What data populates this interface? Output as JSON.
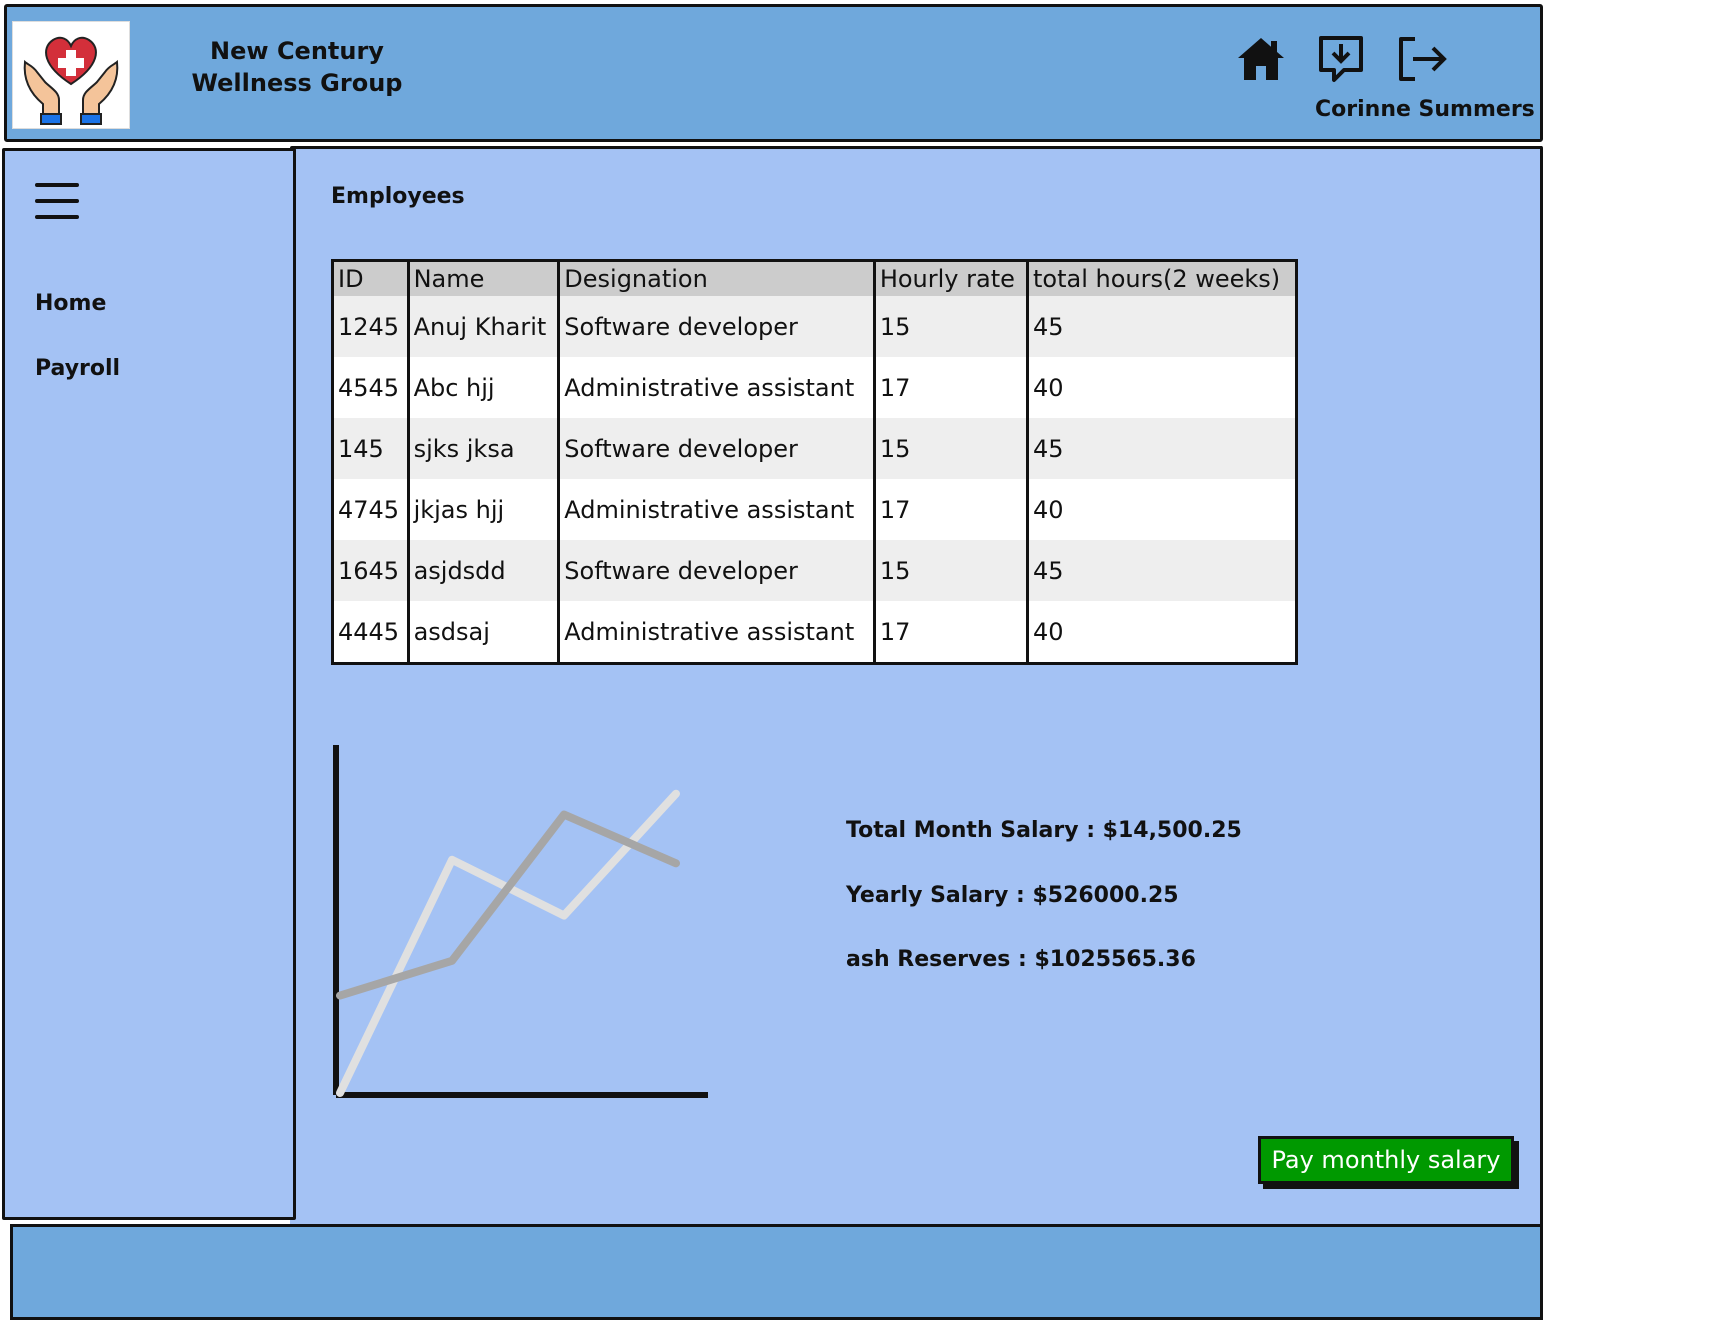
{
  "header": {
    "brand": "New Century Wellness Group",
    "user_name": "Corinne Summers",
    "icons": [
      "home-icon",
      "download-message-icon",
      "logout-icon"
    ]
  },
  "sidebar": {
    "menu_icon": "hamburger-icon",
    "items": [
      {
        "label": "Home"
      },
      {
        "label": "Payroll"
      }
    ]
  },
  "main": {
    "title": "Employees",
    "table": {
      "columns": [
        "ID",
        "Name",
        "Designation",
        "Hourly rate",
        "total hours(2 weeks)"
      ],
      "rows": [
        [
          "1245",
          "Anuj Kharit",
          "Software developer",
          "15",
          "45"
        ],
        [
          "4545",
          "Abc hjj",
          "Administrative assistant",
          "17",
          "40"
        ],
        [
          "145",
          "sjks jksa",
          "Software developer",
          "15",
          "45"
        ],
        [
          "4745",
          "jkjas hjj",
          "Administrative assistant",
          "17",
          "40"
        ],
        [
          "1645",
          "asjdsdd",
          "Software developer",
          "15",
          "45"
        ],
        [
          "4445",
          "asdsaj",
          "Administrative assistant",
          "17",
          "40"
        ]
      ]
    },
    "summary": {
      "total_month_salary": "Total Month Salary : $14,500.25",
      "yearly_salary": "Yearly Salary : $526000.25",
      "cash_reserves": "ash Reserves : $1025565.36"
    },
    "pay_button": "Pay monthly salary"
  },
  "chart_data": {
    "type": "line",
    "x": [
      0,
      1,
      2,
      3
    ],
    "series": [
      {
        "values": [
          0,
          6.7,
          5.1,
          8.6
        ]
      },
      {
        "values": [
          2.8,
          3.8,
          8.0,
          6.6
        ]
      }
    ],
    "ylim": [
      0,
      10
    ],
    "grid": false
  },
  "colors": {
    "header_bg": "#6fa8dc",
    "content_bg": "#a4c2f4",
    "button_bg": "#009900",
    "series_light": "#e0e0e0",
    "series_dark": "#a6a6a6"
  }
}
